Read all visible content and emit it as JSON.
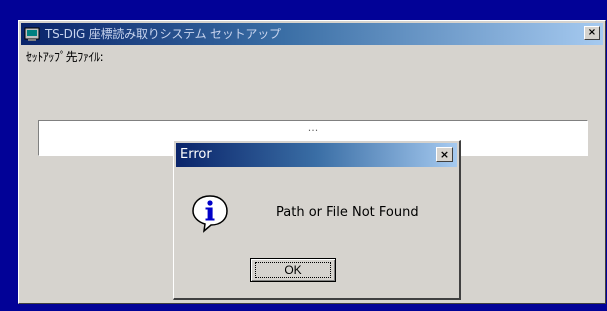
{
  "main_window": {
    "title": "TS-DIG 座標読み取りシステム セットアップ",
    "close_glyph": "×",
    "setup_label": "ｾｯﾄｱｯﾌﾟ先ﾌｧｲﾙ:",
    "path_value": "..."
  },
  "error_dialog": {
    "title": "Error",
    "close_glyph": "×",
    "icon": "info-icon",
    "message": "Path or File Not Found",
    "ok_label": "OK"
  },
  "colors": {
    "desktop": "#020297",
    "titlebar_start": "#0a246a",
    "titlebar_end": "#a6caf0",
    "face": "#d6d3ce"
  }
}
